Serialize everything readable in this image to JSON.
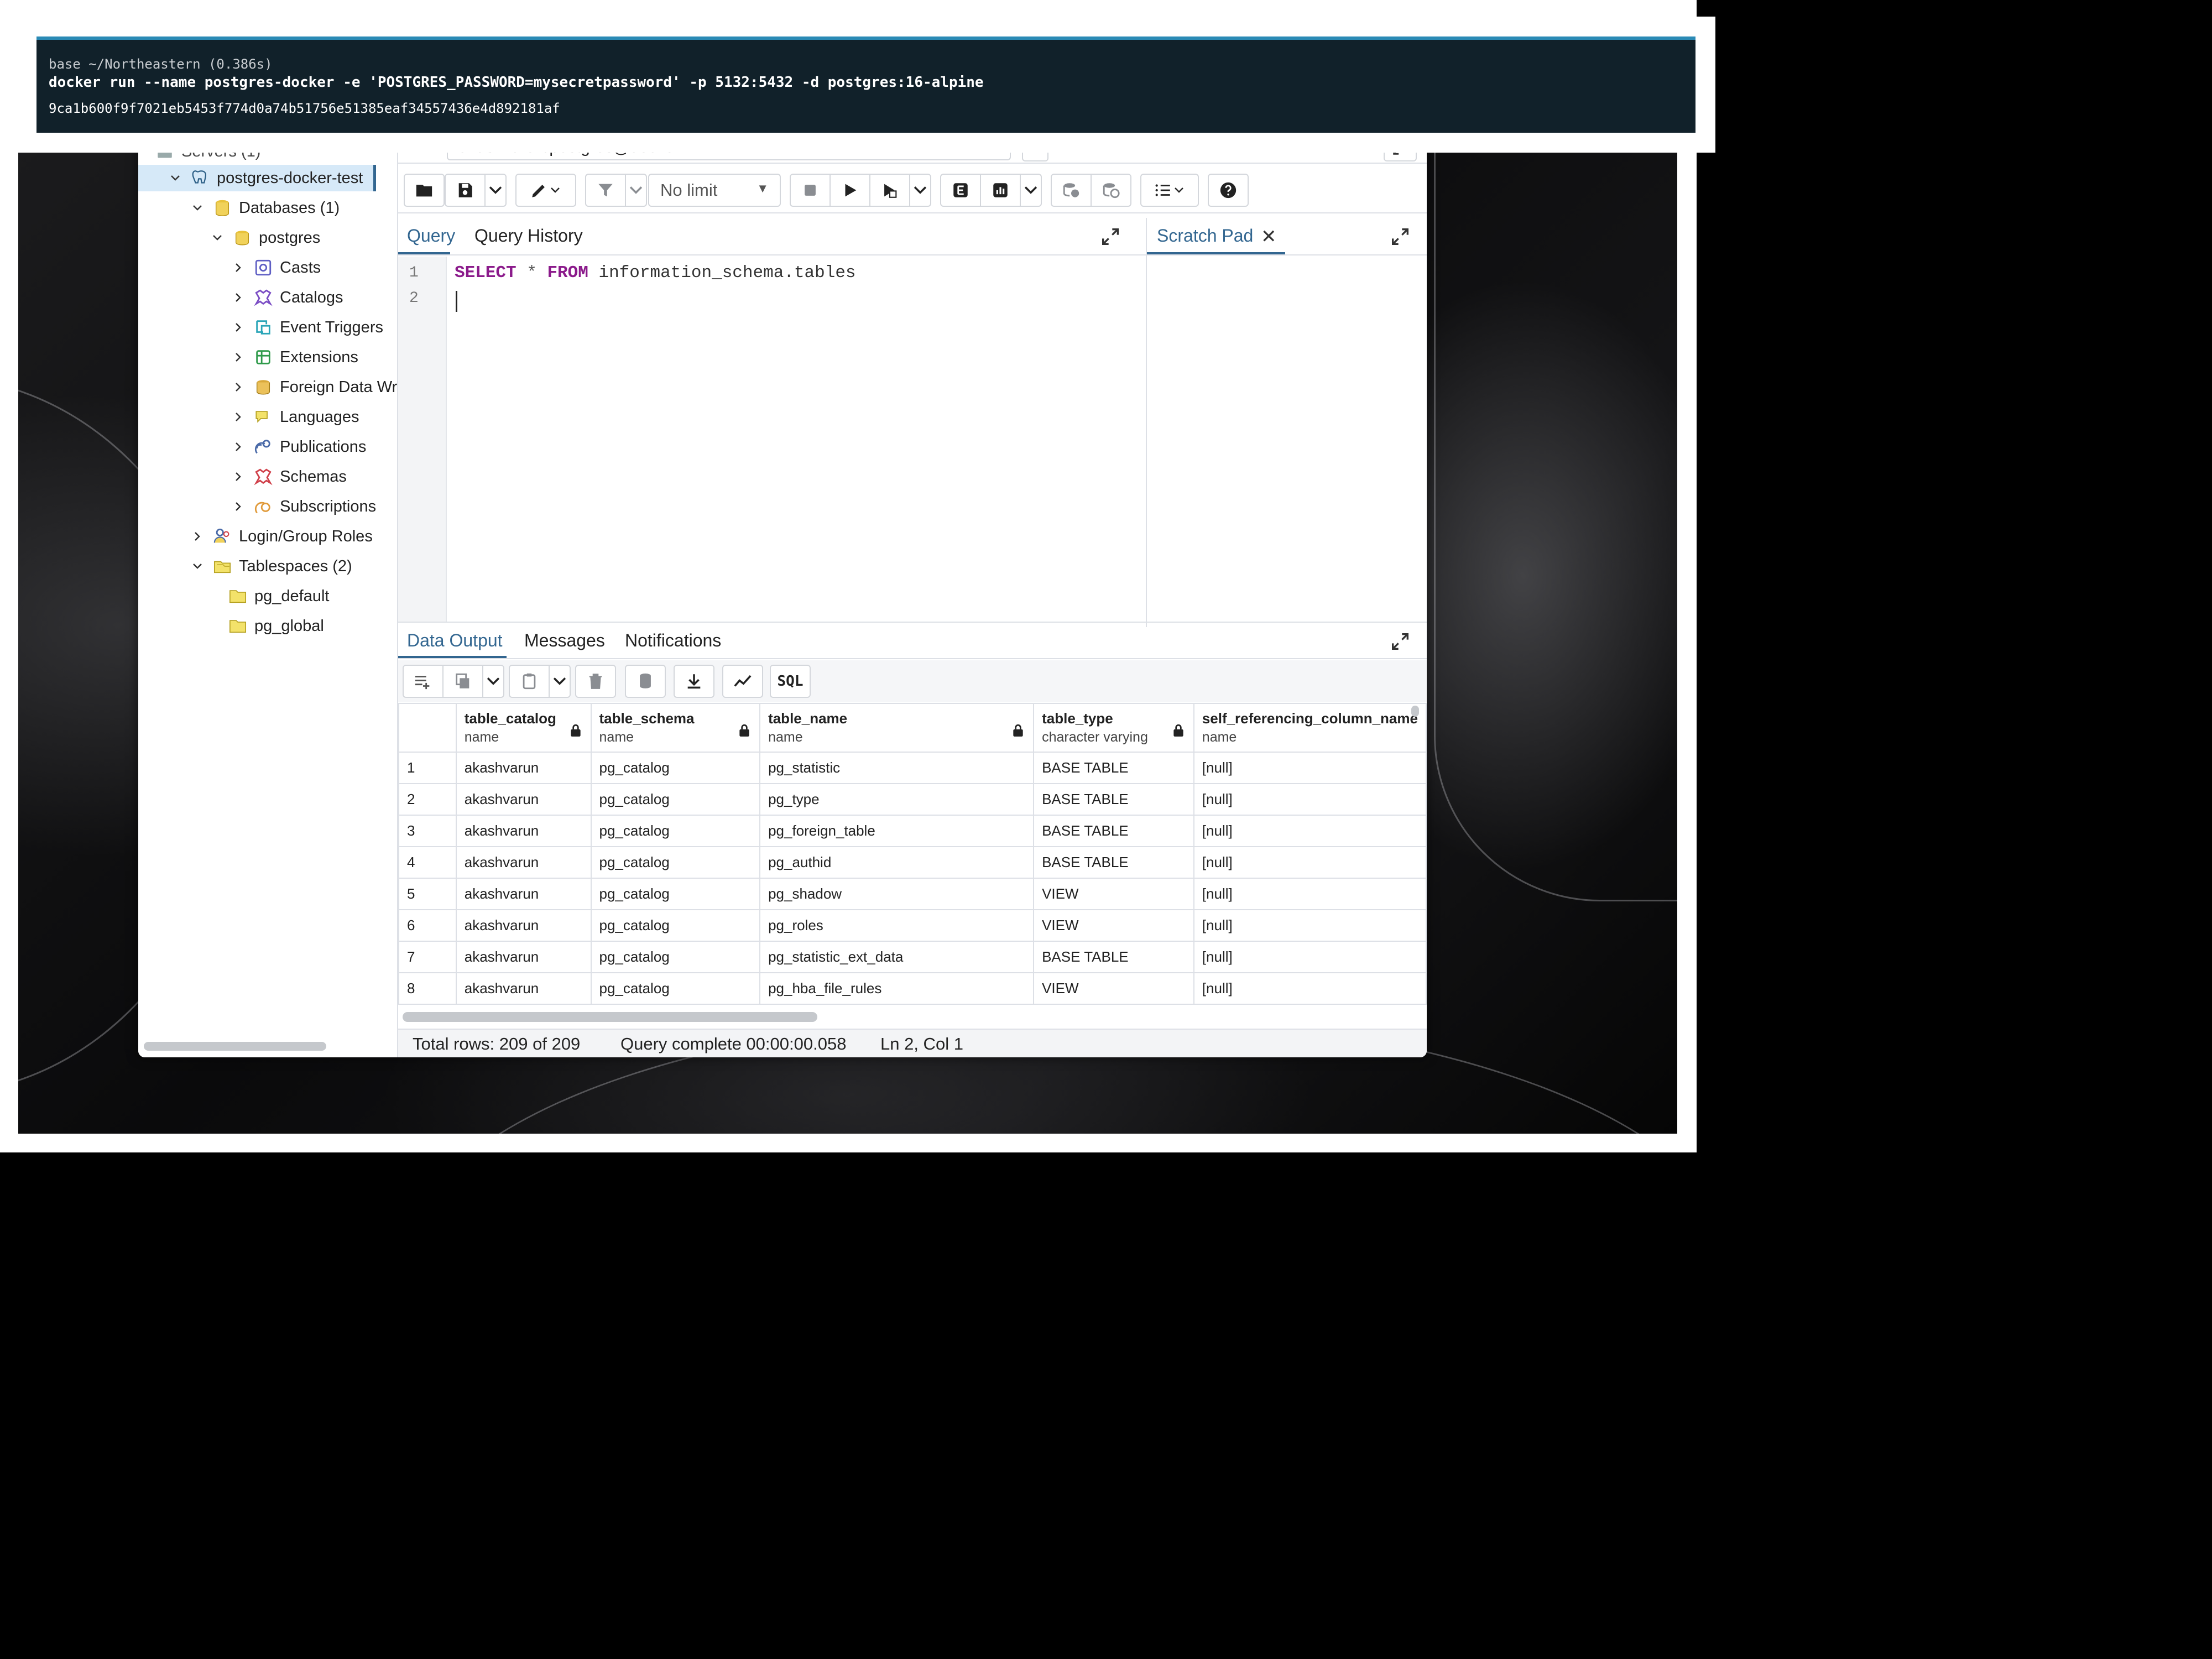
{
  "terminal": {
    "prompt": "base ~/Northeastern (0.386s)",
    "command": "docker run --name postgres-docker -e 'POSTGRES_PASSWORD=mysecretpassword' -p 5132:5432 -d postgres:16-alpine",
    "output": "9ca1b600f9f7021eb5453f774d0a74b51756e51385eaf34557436e4d892181af"
  },
  "tree": {
    "servers_label": "Servers (1)",
    "server": "postgres-docker-test",
    "databases": "Databases (1)",
    "db": "postgres",
    "children": [
      "Casts",
      "Catalogs",
      "Event Triggers",
      "Extensions",
      "Foreign Data Wr",
      "Languages",
      "Publications",
      "Schemas",
      "Subscriptions"
    ],
    "login_roles": "Login/Group Roles",
    "tablespaces": "Tablespaces (2)",
    "tablespace_items": [
      "pg_default",
      "pg_global"
    ]
  },
  "toolbar": {
    "connection": "akashvarun/postgres@docker",
    "limit": "No limit",
    "sql_label": "SQL"
  },
  "editor_tabs": {
    "query": "Query",
    "history": "Query History",
    "scratch": "Scratch Pad"
  },
  "editor": {
    "line_numbers": [
      "1",
      "2"
    ],
    "kw_select": "SELECT",
    "star": " * ",
    "kw_from": "FROM",
    "rest": " information_schema.tables"
  },
  "output_tabs": {
    "data": "Data Output",
    "messages": "Messages",
    "notifications": "Notifications"
  },
  "grid": {
    "columns": [
      {
        "name": "table_catalog",
        "type": "name"
      },
      {
        "name": "table_schema",
        "type": "name"
      },
      {
        "name": "table_name",
        "type": "name"
      },
      {
        "name": "table_type",
        "type": "character varying"
      },
      {
        "name": "self_referencing_column_name",
        "type": "name"
      }
    ],
    "rows": [
      [
        "1",
        "akashvarun",
        "pg_catalog",
        "pg_statistic",
        "BASE TABLE",
        "[null]"
      ],
      [
        "2",
        "akashvarun",
        "pg_catalog",
        "pg_type",
        "BASE TABLE",
        "[null]"
      ],
      [
        "3",
        "akashvarun",
        "pg_catalog",
        "pg_foreign_table",
        "BASE TABLE",
        "[null]"
      ],
      [
        "4",
        "akashvarun",
        "pg_catalog",
        "pg_authid",
        "BASE TABLE",
        "[null]"
      ],
      [
        "5",
        "akashvarun",
        "pg_catalog",
        "pg_shadow",
        "VIEW",
        "[null]"
      ],
      [
        "6",
        "akashvarun",
        "pg_catalog",
        "pg_roles",
        "VIEW",
        "[null]"
      ],
      [
        "7",
        "akashvarun",
        "pg_catalog",
        "pg_statistic_ext_data",
        "BASE TABLE",
        "[null]"
      ],
      [
        "8",
        "akashvarun",
        "pg_catalog",
        "pg_hba_file_rules",
        "VIEW",
        "[null]"
      ]
    ]
  },
  "status": {
    "rows": "Total rows: 209 of 209",
    "complete": "Query complete 00:00:00.058",
    "cursor": "Ln 2, Col 1"
  },
  "colors": {
    "accent": "#326690",
    "terminal_bg": "#11212a",
    "selected_row": "#d6e9f8",
    "keyword": "#8b1a8b"
  }
}
